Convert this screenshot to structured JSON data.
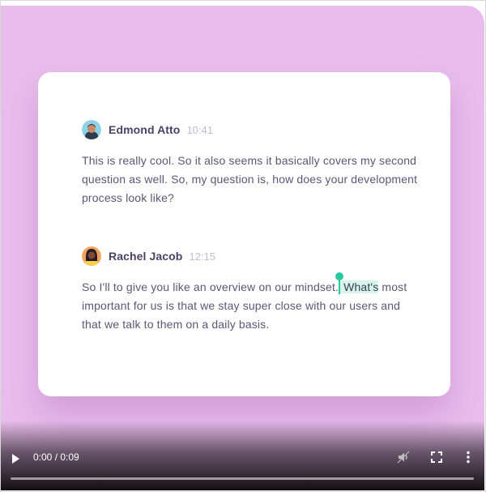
{
  "messages": [
    {
      "name": "Edmond Atto",
      "time": "10:41",
      "text": "This is really cool. So it also seems it basically covers my second question as well. So, my question is, how does your development process look like?"
    },
    {
      "name": "Rachel Jacob",
      "time": "12:15",
      "text_before": "So I'll to give you like an overview on our mindset.",
      "highlight": " What's",
      "text_after": " most important for us is that we stay super close with our users and that we talk to them on a daily basis."
    }
  ],
  "player": {
    "time_display": "0:00 / 0:09",
    "progress": 0.0,
    "icons": [
      "play-icon",
      "volume-icon",
      "fullscreen-icon",
      "more-options-icon"
    ]
  },
  "colors": {
    "background": "#e8bdec",
    "card": "#ffffff",
    "name_text": "#4a4166",
    "timestamp": "#c2bcd4",
    "body_text": "#5c5676",
    "highlight": "#d6f6ec",
    "caret": "#27c9a0"
  }
}
